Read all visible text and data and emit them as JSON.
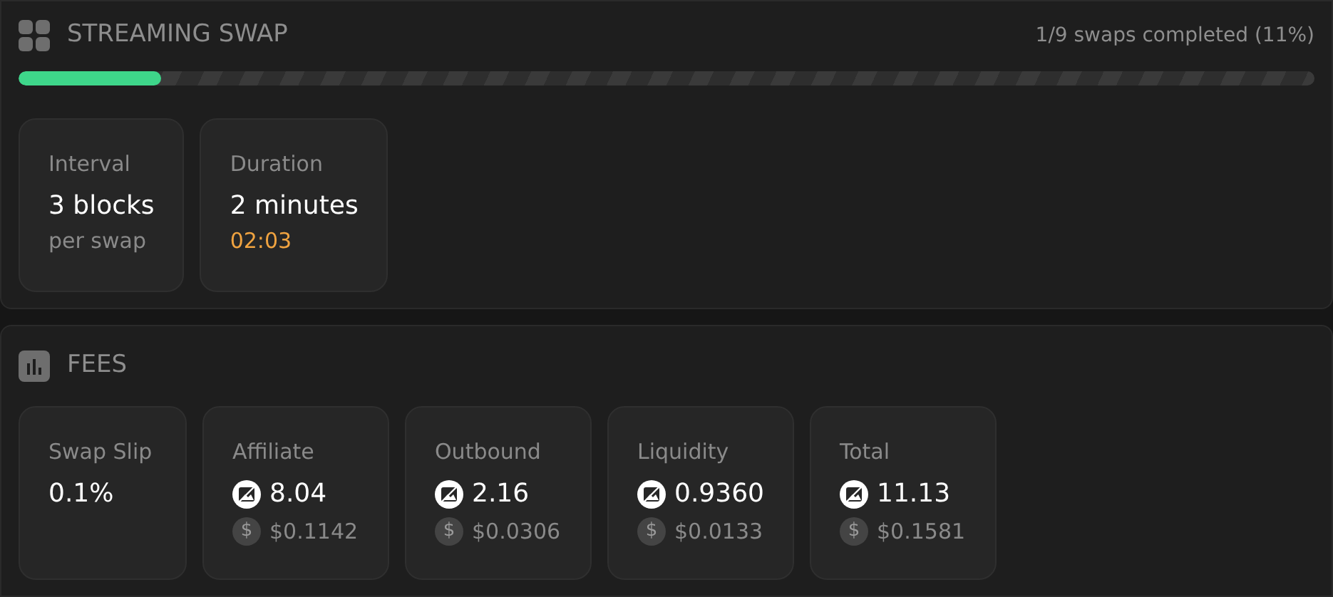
{
  "streaming_swap": {
    "title": "STREAMING SWAP",
    "status": "1/9 swaps completed (11%)",
    "progress": {
      "level": 0.11
    },
    "cards": [
      {
        "label": "Interval",
        "value": "3 blocks",
        "sub": "per swap",
        "kind": "muted"
      },
      {
        "label": "Duration",
        "value": "2 minutes",
        "sub": "02:03",
        "kind": "timer"
      }
    ]
  },
  "fees": {
    "title": "FEES",
    "items": [
      {
        "kind": "plain",
        "label": "Swap Slip",
        "value": "0.1%"
      },
      {
        "kind": "asset",
        "label": "Affiliate",
        "value": "8.04",
        "usd_symbol": "$",
        "usd": "$0.1142"
      },
      {
        "kind": "asset",
        "label": "Outbound",
        "value": "2.16",
        "usd_symbol": "$",
        "usd": "$0.0306"
      },
      {
        "kind": "asset",
        "label": "Liquidity",
        "value": "0.9360",
        "usd_symbol": "$",
        "usd": "$0.0133"
      },
      {
        "kind": "asset",
        "label": "Total",
        "value": "11.13",
        "usd_symbol": "$",
        "usd": "$0.1581"
      }
    ]
  }
}
